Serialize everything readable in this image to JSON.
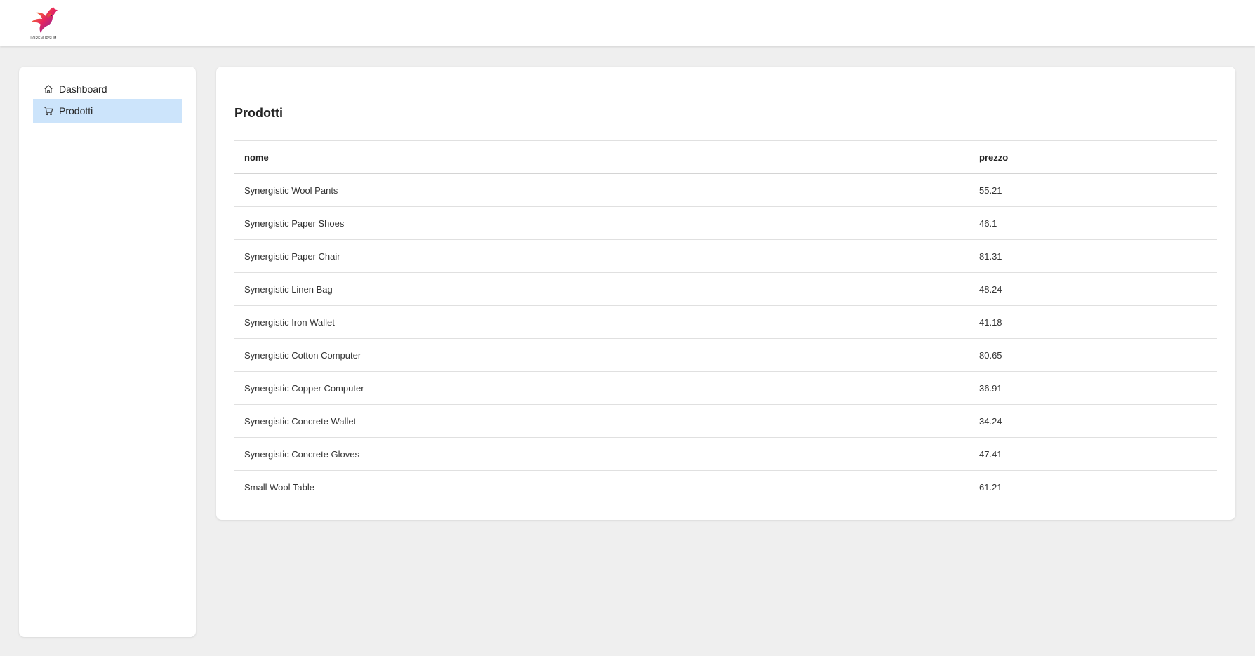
{
  "header": {
    "logo_text": "LOREM IPSUM"
  },
  "sidebar": {
    "items": [
      {
        "label": "Dashboard",
        "icon": "home-icon",
        "active": false
      },
      {
        "label": "Prodotti",
        "icon": "cart-icon",
        "active": true
      }
    ]
  },
  "main": {
    "title": "Prodotti",
    "table": {
      "columns": [
        "nome",
        "prezzo"
      ],
      "rows": [
        {
          "nome": "Synergistic Wool Pants",
          "prezzo": "55.21"
        },
        {
          "nome": "Synergistic Paper Shoes",
          "prezzo": "46.1"
        },
        {
          "nome": "Synergistic Paper Chair",
          "prezzo": "81.31"
        },
        {
          "nome": "Synergistic Linen Bag",
          "prezzo": "48.24"
        },
        {
          "nome": "Synergistic Iron Wallet",
          "prezzo": "41.18"
        },
        {
          "nome": "Synergistic Cotton Computer",
          "prezzo": "80.65"
        },
        {
          "nome": "Synergistic Copper Computer",
          "prezzo": "36.91"
        },
        {
          "nome": "Synergistic Concrete Wallet",
          "prezzo": "34.24"
        },
        {
          "nome": "Synergistic Concrete Gloves",
          "prezzo": "47.41"
        },
        {
          "nome": "Small Wool Table",
          "prezzo": "61.21"
        }
      ]
    }
  },
  "colors": {
    "background": "#efefef",
    "surface": "#ffffff",
    "active_nav": "#cce4fb"
  }
}
